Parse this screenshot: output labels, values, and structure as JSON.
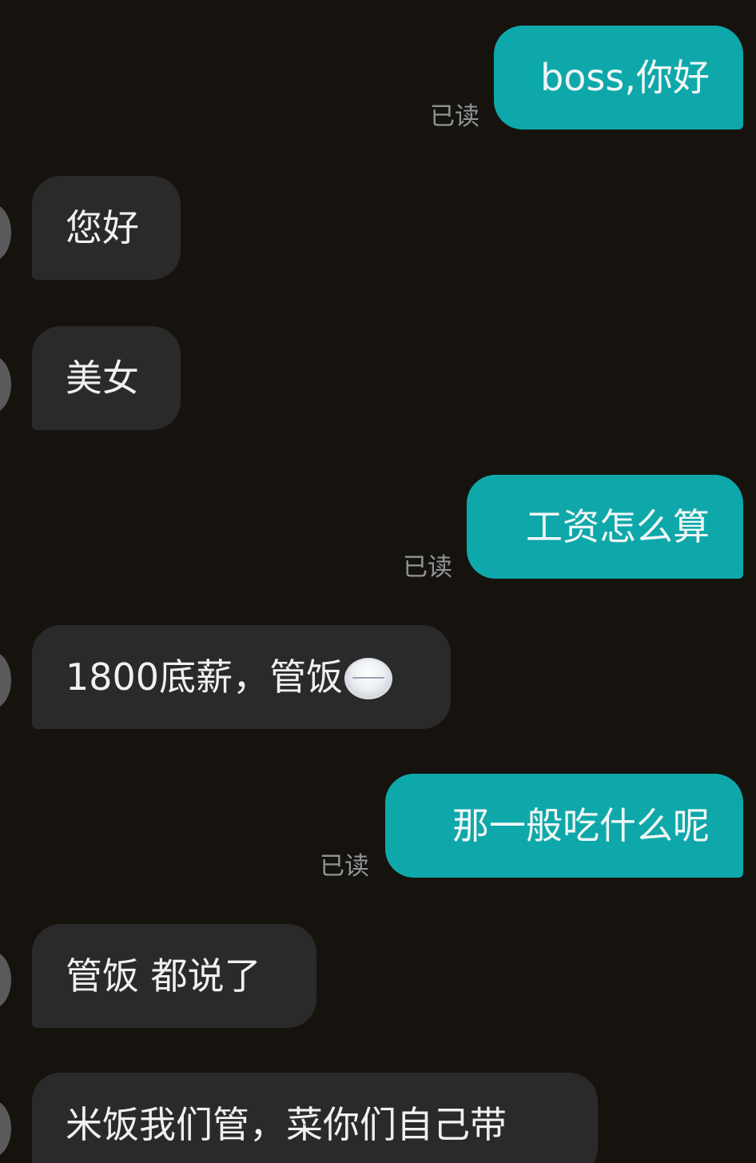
{
  "chat": {
    "read_label": "已读",
    "messages": [
      {
        "side": "sent",
        "text": "boss,你好"
      },
      {
        "side": "received",
        "text": "您好"
      },
      {
        "side": "received",
        "text": "美女"
      },
      {
        "side": "sent",
        "text": "工资怎么算"
      },
      {
        "side": "received",
        "text": "1800底薪，管饭",
        "emoji": "white-ball-emoji"
      },
      {
        "side": "sent",
        "text": "那一般吃什么呢"
      },
      {
        "side": "received",
        "text": "管饭 都说了"
      },
      {
        "side": "received",
        "text": "米饭我们管，菜你们自己带"
      }
    ]
  },
  "colors": {
    "background": "#16130f",
    "sent_bubble": "#0ea8aa",
    "received_bubble": "#2b2a2a",
    "read_status": "#8f9596"
  }
}
